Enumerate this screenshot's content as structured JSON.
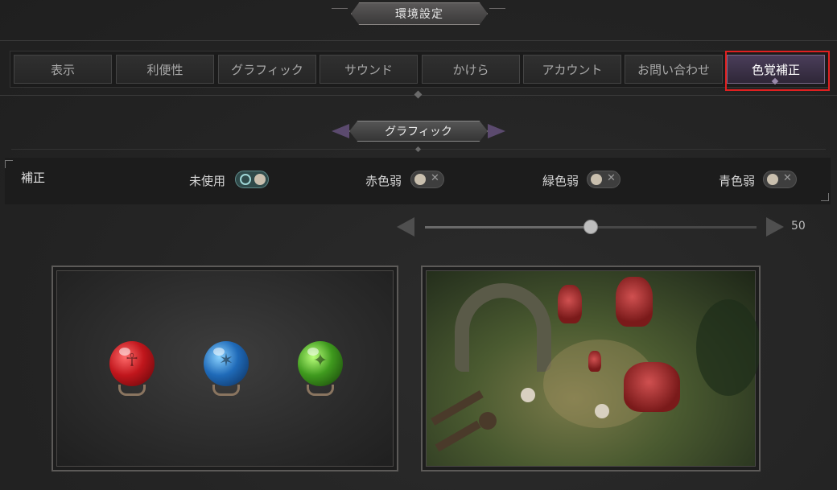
{
  "window": {
    "title": "環境設定"
  },
  "tabs": [
    {
      "label": "表示",
      "active": false
    },
    {
      "label": "利便性",
      "active": false
    },
    {
      "label": "グラフィック",
      "active": false
    },
    {
      "label": "サウンド",
      "active": false
    },
    {
      "label": "かけら",
      "active": false
    },
    {
      "label": "アカウント",
      "active": false
    },
    {
      "label": "お問い合わせ",
      "active": false
    },
    {
      "label": "色覚補正",
      "active": true
    }
  ],
  "section": {
    "title": "グラフィック"
  },
  "correction": {
    "label": "補正",
    "options": [
      {
        "label": "未使用",
        "on": true
      },
      {
        "label": "赤色弱",
        "on": false
      },
      {
        "label": "緑色弱",
        "on": false
      },
      {
        "label": "青色弱",
        "on": false
      }
    ]
  },
  "slider": {
    "value": "50",
    "level_fraction": 0.5
  },
  "preview": {
    "orbs": [
      "red-orb",
      "blue-orb",
      "green-orb"
    ]
  },
  "colors": {
    "accent_active_tab": "#4a3d5a",
    "highlight_outline": "#e02020",
    "toggle_on": "#9fd6d6"
  }
}
